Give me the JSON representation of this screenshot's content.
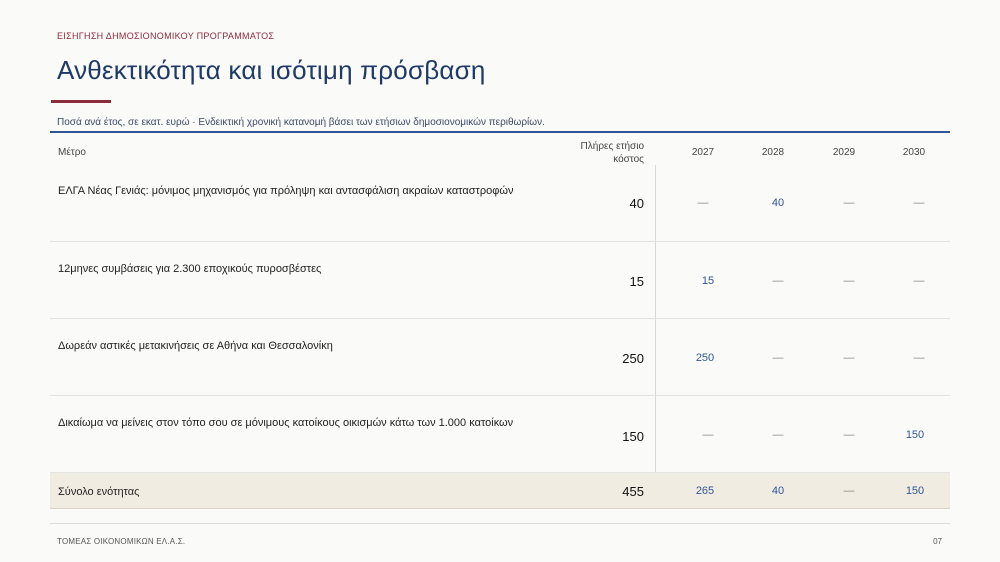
{
  "header": {
    "eyebrow": "ΕΙΣΗΓΗΣΗ ΔΗΜΟΣΙΟΝΟΜΙΚΟΥ ΠΡΟΓΡΑΜΜΑΤΟΣ",
    "title": "Ανθεκτικότητα και ισότιμη πρόσβαση",
    "subtitle": "Ποσά ανά έτος, σε εκατ. ευρώ · Ενδεικτική χρονική κατανομή βάσει των ετήσιων δημοσιονομικών περιθωρίων."
  },
  "table": {
    "headers": {
      "measure": "Μέτρο",
      "full_cost_line1": "Πλήρες ετήσιο",
      "full_cost_line2": "κόστος",
      "y2027": "2027",
      "y2028": "2028",
      "y2029": "2029",
      "y2030": "2030"
    },
    "rows": [
      {
        "desc": "ΕΛΓΑ Νέας Γενιάς: μόνιμος μηχανισμός για πρόληψη και αντασφάλιση ακραίων καταστροφών",
        "full": "40",
        "y2027": "—",
        "y2028": "40",
        "y2029": "—",
        "y2030": "—"
      },
      {
        "desc": "12μηνες συμβάσεις για 2.300 εποχικούς πυροσβέστες",
        "full": "15",
        "y2027": "15",
        "y2028": "—",
        "y2029": "—",
        "y2030": "—"
      },
      {
        "desc": "Δωρεάν αστικές μετακινήσεις σε Αθήνα και Θεσσαλονίκη",
        "full": "250",
        "y2027": "250",
        "y2028": "—",
        "y2029": "—",
        "y2030": "—"
      },
      {
        "desc": "Δικαίωμα να μείνεις στον τόπο σου σε μόνιμους κατοίκους οικισμών κάτω των 1.000 κατοίκων",
        "full": "150",
        "y2027": "—",
        "y2028": "—",
        "y2029": "—",
        "y2030": "150"
      }
    ],
    "total": {
      "desc": "Σύνολο ενότητας",
      "full": "455",
      "y2027": "265",
      "y2028": "40",
      "y2029": "—",
      "y2030": "150"
    }
  },
  "footer": {
    "left": "ΤΟΜΕΑΣ ΟΙΚΟΝΟΜΙΚΩΝ ΕΛ.Α.Σ.",
    "page": "07"
  }
}
